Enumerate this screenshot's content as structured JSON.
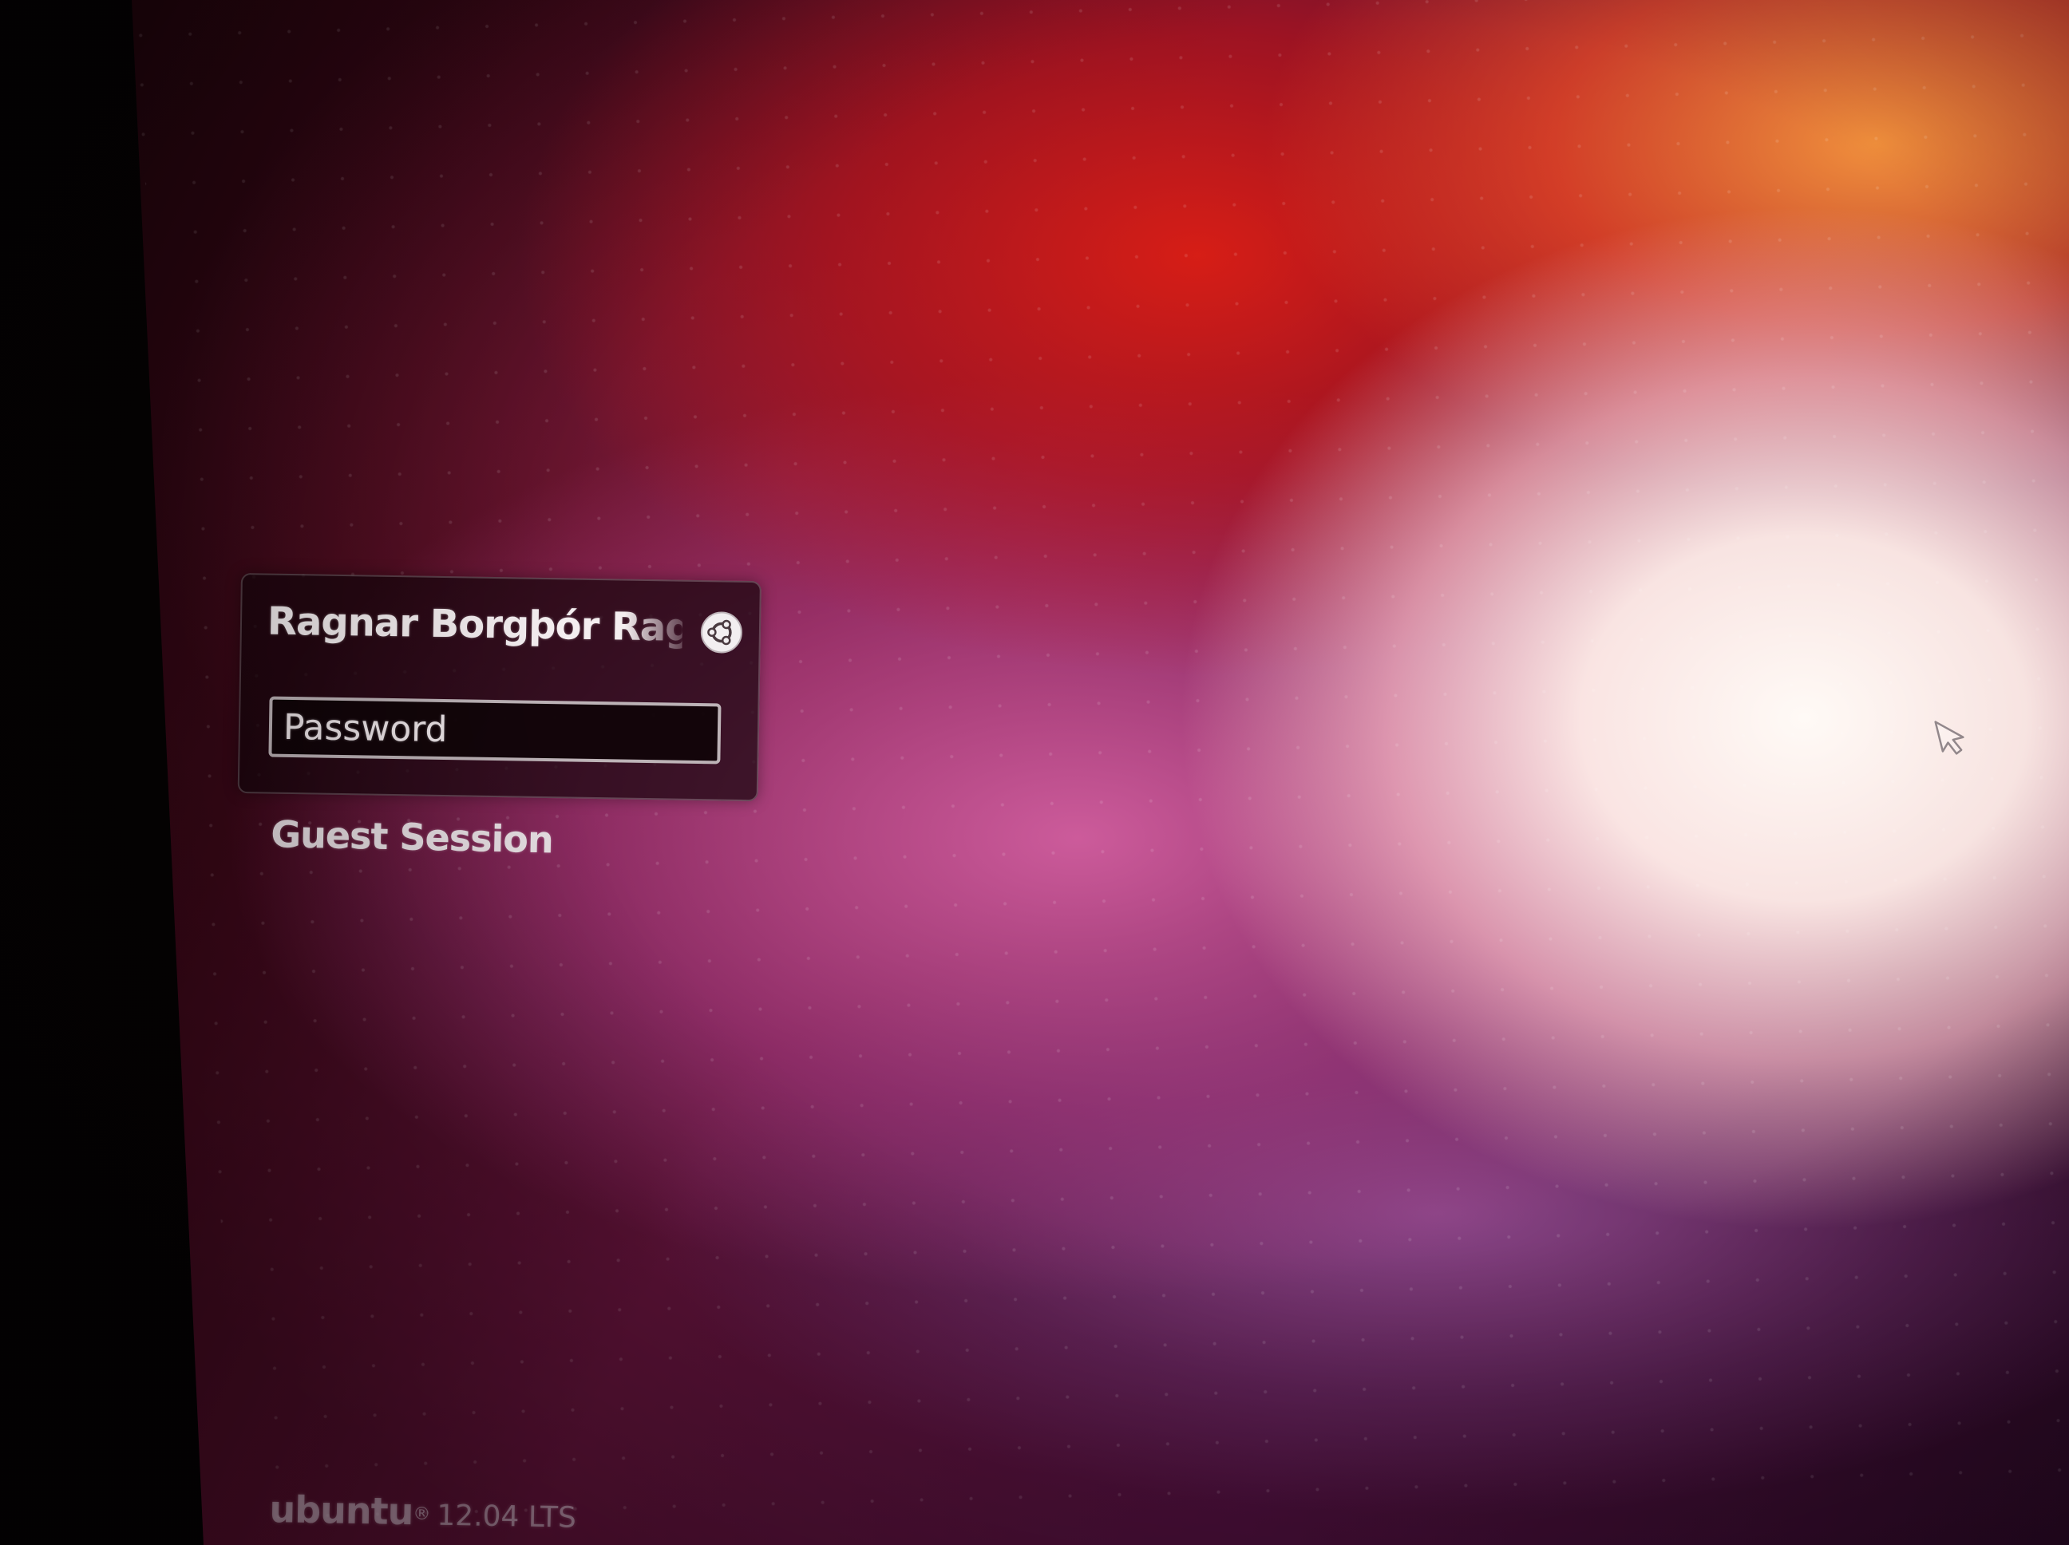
{
  "greeter": {
    "user_name": "Ragnar Borgþór Ragnarsson",
    "password_placeholder": "Password",
    "password_value": "",
    "guest_session_label": "Guest Session",
    "session_icon": "ubuntu-session-icon"
  },
  "footer": {
    "brand": "ubuntu",
    "registered_mark": "®",
    "version": "12.04 LTS"
  },
  "cursor": {
    "icon": "mouse-pointer-icon"
  },
  "colors": {
    "wallpaper_dark": "#3a0717",
    "wallpaper_red": "#d21e14",
    "wallpaper_pink": "#d25fa0",
    "panel_background": "#16060c",
    "text": "#f4eef0"
  }
}
